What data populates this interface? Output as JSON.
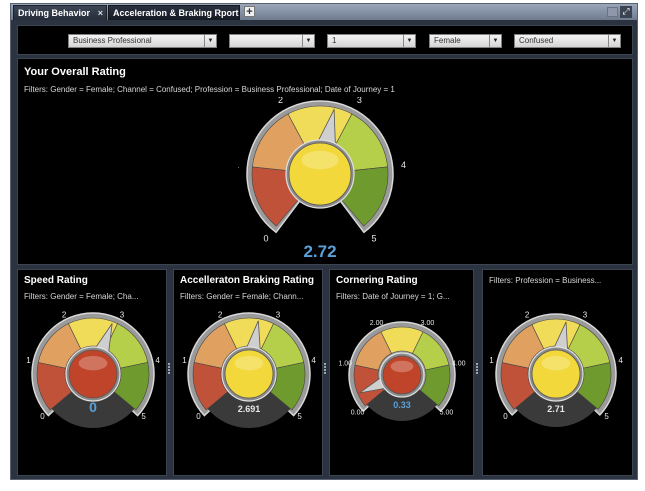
{
  "tabs": [
    {
      "label": "Driving Behavior",
      "close": "×"
    },
    {
      "label": "Acceleration & Braking Rport"
    }
  ],
  "tab_add_label": "+",
  "filters": {
    "profession": "Business Professional",
    "blank": "",
    "date_of_journey": "1",
    "gender": "Female",
    "channel": "Confused"
  },
  "overall": {
    "title": "Your Overall Rating",
    "filters": "Filters:  Gender = Female; Channel = Confused; Profession = Business Professional; Date of Journey = 1",
    "value_label": "2.72",
    "value": 2.72,
    "ticks": [
      "0",
      "1",
      "2",
      "3",
      "4",
      "5"
    ]
  },
  "panels": [
    {
      "title": "Speed Rating",
      "filters": "Filters:  Gender = Female; Cha...",
      "value_label": "0",
      "value": 2.9,
      "ticks": [
        "0",
        "1",
        "2",
        "3",
        "4",
        "5"
      ],
      "center_color": "#c0442a",
      "value_color": "#5aa0d8"
    },
    {
      "title": "Accelleraton Braking Rating",
      "filters": "Filters:  Gender = Female; Chann...",
      "value_label": "2.691",
      "value": 2.691,
      "ticks": [
        "0",
        "1",
        "2",
        "3",
        "4",
        "5"
      ],
      "center_color": "#f2d83a",
      "value_color": "#e8e8e8"
    },
    {
      "title": "Cornering Rating",
      "filters": "Filters:  Date of Journey = 1; G...",
      "value_label": "0.33",
      "value": 0.33,
      "ticks": [
        "0.00",
        "1.00",
        "2.00",
        "3.00",
        "4.00",
        "5.00"
      ],
      "center_color": "#c0442a",
      "value_color": "#5aa0d8"
    },
    {
      "title": "",
      "filters": "Filters:  Profession = Business...",
      "value_label": "2.71",
      "value": 2.71,
      "ticks": [
        "0",
        "1",
        "2",
        "3",
        "4",
        "5"
      ],
      "center_color": "#f2d83a",
      "value_color": "#e8e8e8"
    }
  ],
  "colors": {
    "red": "#c0523a",
    "orange": "#e0a060",
    "yellow": "#f0dc58",
    "lightgreen": "#b6cf4a",
    "green": "#6f9a2e",
    "accent_value": "#5aa0d8"
  }
}
